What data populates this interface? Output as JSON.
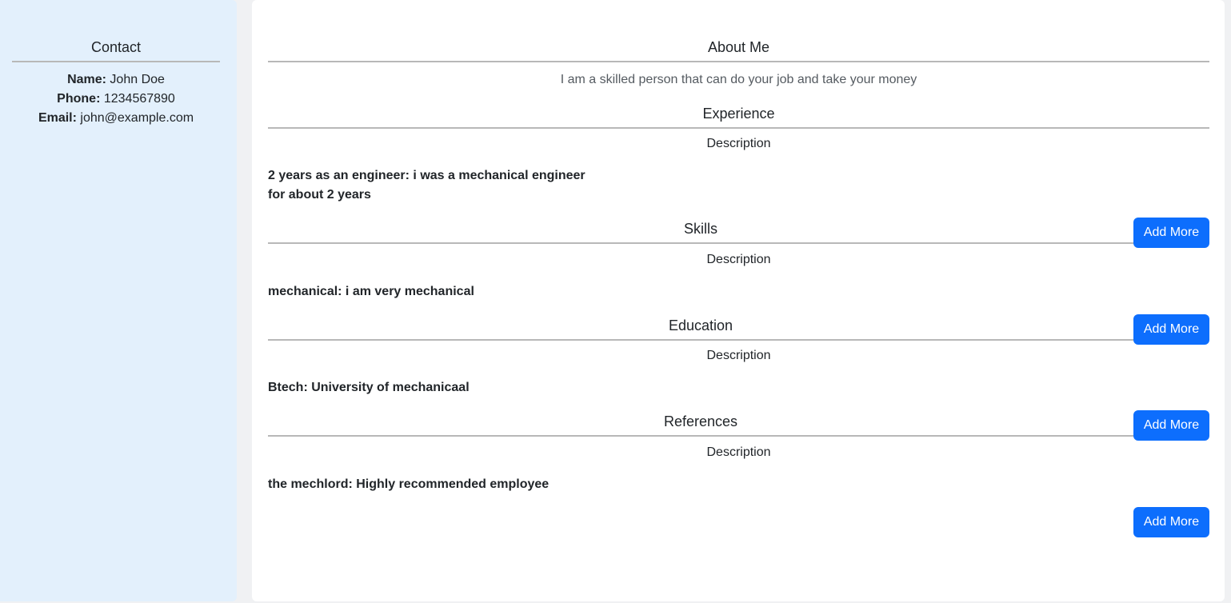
{
  "sidebar": {
    "heading": "Contact",
    "name_label": "Name:",
    "name_value": "John Doe",
    "phone_label": "Phone:",
    "phone_value": "1234567890",
    "email_label": "Email:",
    "email_value": "john@example.com"
  },
  "about": {
    "heading": "About Me",
    "text": "I am a skilled person that can do your job and take your money"
  },
  "experience": {
    "heading": "Experience",
    "description_label": "Description",
    "entry_line1": "2 years as an engineer: i was a mechanical engineer",
    "entry_line2": "for about 2 years",
    "add_label": "Add More"
  },
  "skills": {
    "heading": "Skills",
    "description_label": "Description",
    "entry": "mechanical: i am very mechanical",
    "add_label": "Add More"
  },
  "education": {
    "heading": "Education",
    "description_label": "Description",
    "entry": "Btech: University of mechanicaal",
    "add_label": "Add More"
  },
  "references": {
    "heading": "References",
    "description_label": "Description",
    "entry": "the mechlord: Highly recommended employee",
    "add_label": "Add More"
  },
  "colors": {
    "sidebar_bg": "#e3f0fc",
    "primary_button": "#0d6efd",
    "divider": "#b8b8b8"
  }
}
